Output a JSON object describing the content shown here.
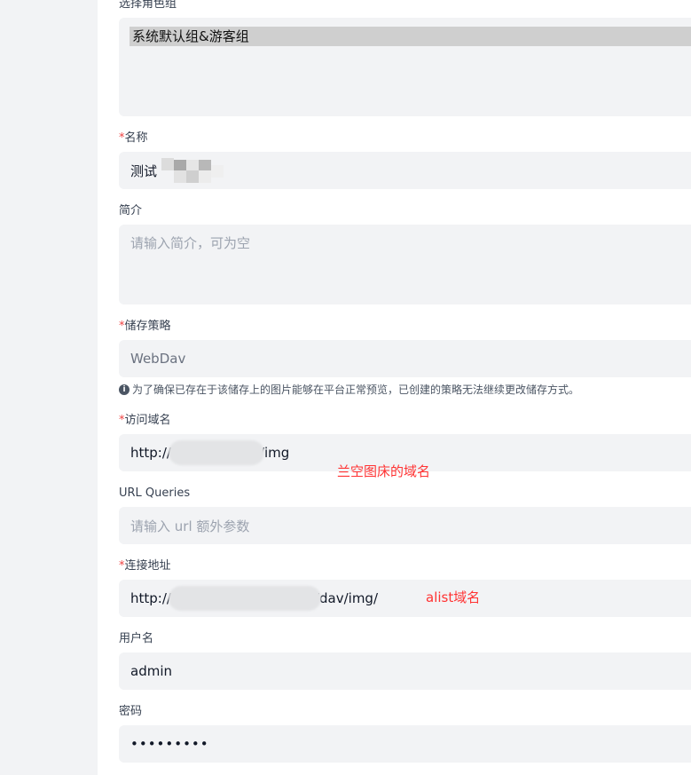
{
  "role_group": {
    "label": "选择角色组",
    "selected": "系统默认组&游客组"
  },
  "name": {
    "required": "*",
    "label": "名称",
    "value": "测试"
  },
  "intro": {
    "label": "简介",
    "placeholder": "请输入简介，可为空"
  },
  "storage": {
    "required": "*",
    "label": "储存策略",
    "value": "WebDav",
    "hint": "为了确保已存在于该储存上的图片能够在平台正常预览，已创建的策略无法继续更改储存方式。",
    "hint_icon": "info-icon"
  },
  "access_domain": {
    "required": "*",
    "label": "访问域名",
    "value_prefix": "http://",
    "value_suffix": "/img",
    "annotation": "兰空图床的域名"
  },
  "url_queries": {
    "label": "URL Queries",
    "placeholder": "请输入 url 额外参数"
  },
  "connect_address": {
    "required": "*",
    "label": "连接地址",
    "value_prefix": "http://",
    "value_suffix": "/dav/img/",
    "annotation": "alist域名"
  },
  "username": {
    "label": "用户名",
    "value": "admin"
  },
  "password": {
    "label": "密码",
    "value": "•••••••••"
  },
  "colors": {
    "field_bg": "#f2f3f5",
    "required": "#ef4444",
    "annotation": "#ff3333",
    "gutter": "#f2f3f5"
  }
}
